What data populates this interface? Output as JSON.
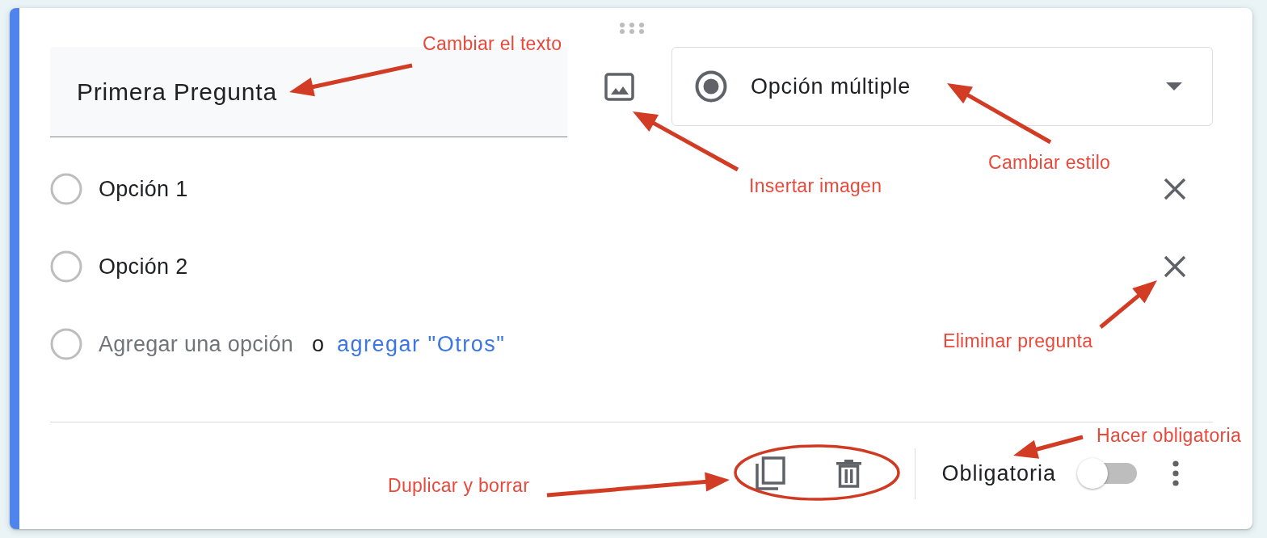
{
  "question": {
    "focused": true,
    "title": "Primera Pregunta",
    "type": "Opción múltiple",
    "options": [
      {
        "label": "Opción 1",
        "selected": false
      },
      {
        "label": "Opción 2",
        "selected": false
      }
    ],
    "add_option": {
      "placeholder": "Agregar una opción",
      "separator": "o",
      "link": "agregar \"Otros\""
    },
    "footer": {
      "required_label": "Obligatoria",
      "required": false
    }
  },
  "annotations": [
    {
      "text": "Cambiar el texto",
      "kind": "arrow"
    },
    {
      "text": "Insertar imagen",
      "kind": "arrow"
    },
    {
      "text": "Cambiar estilo",
      "kind": "arrow"
    },
    {
      "text": "Eliminar pregunta",
      "kind": "arrow"
    },
    {
      "text": "Hacer obligatoria",
      "kind": "arrow"
    },
    {
      "text": "Duplicar y borrar",
      "kind": "encircle"
    }
  ]
}
